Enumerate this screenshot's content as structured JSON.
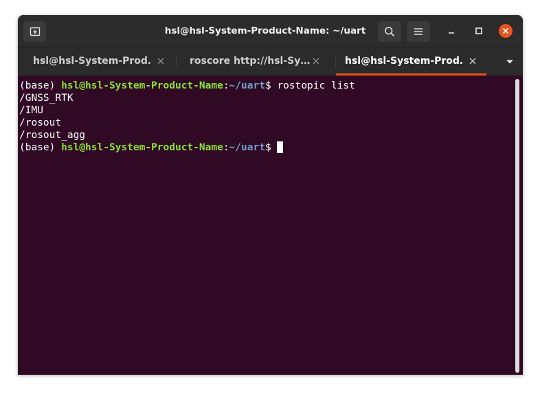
{
  "window": {
    "title": "hsl@hsl-System-Product-Name: ~/uart"
  },
  "header": {
    "new_tab_icon": "new-tab-icon",
    "search_icon": "search-icon",
    "menu_icon": "hamburger-menu-icon",
    "minimize_icon": "minimize-icon",
    "maximize_icon": "maximize-icon",
    "close_icon": "close-icon",
    "close_color": "#e95420"
  },
  "tabs": [
    {
      "label": "hsl@hsl-System-Prod…",
      "active": false
    },
    {
      "label": "roscore http://hsl-Sy…",
      "active": false
    },
    {
      "label": "hsl@hsl-System-Prod…",
      "active": true
    }
  ],
  "colors": {
    "terminal_bg": "#300a24",
    "prompt_user": "#8ae234",
    "prompt_path": "#729fcf",
    "accent": "#e95420"
  },
  "terminal": {
    "lines": [
      {
        "env": "(base) ",
        "user": "hsl@hsl-System-Product-Name",
        "sep": ":",
        "path": "~/uart",
        "dollar": "$ ",
        "cmd": "rostopic list"
      },
      {
        "text": "/GNSS_RTK"
      },
      {
        "text": "/IMU"
      },
      {
        "text": "/rosout"
      },
      {
        "text": "/rosout_agg"
      },
      {
        "env": "(base) ",
        "user": "hsl@hsl-System-Product-Name",
        "sep": ":",
        "path": "~/uart",
        "dollar": "$ ",
        "cmd": ""
      }
    ]
  }
}
